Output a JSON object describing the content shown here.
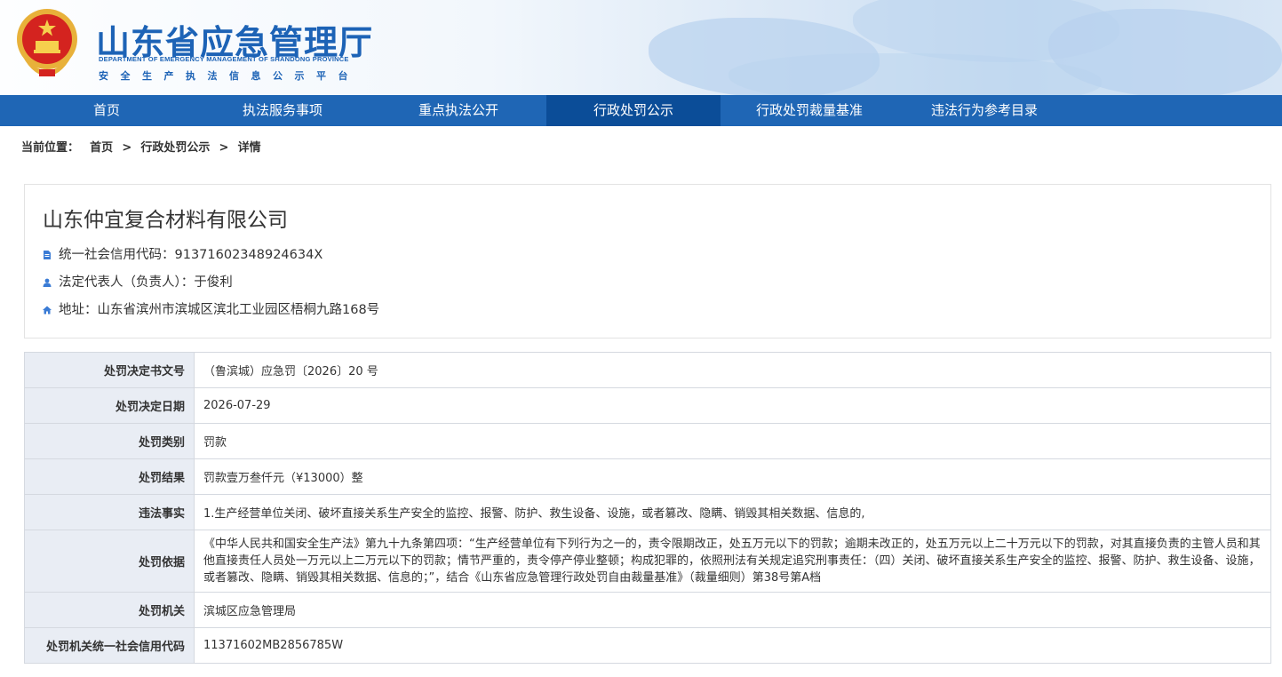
{
  "header": {
    "title": "山东省应急管理厅",
    "subtitle_en": "DEPARTMENT OF EMERGENCY MANAGEMENT OF SHANDONG PROVINCE",
    "platform": "安全生产执法信息公示平台"
  },
  "nav": {
    "items": [
      {
        "label": "首页"
      },
      {
        "label": "执法服务事项"
      },
      {
        "label": "重点执法公开"
      },
      {
        "label": "行政处罚公示",
        "active": true
      },
      {
        "label": "行政处罚裁量基准"
      },
      {
        "label": "违法行为参考目录"
      }
    ]
  },
  "breadcrumb": {
    "label": "当前位置：",
    "items": [
      "首页",
      "行政处罚公示",
      "详情"
    ],
    "separator": ">"
  },
  "company": {
    "name": "山东仲宜复合材料有限公司",
    "credit_code": "统一社会信用代码：91371602348924634X",
    "legal_rep": "法定代表人（负责人）：于俊利",
    "address": "地址：山东省滨州市滨城区滨北工业园区梧桐九路168号"
  },
  "details": [
    {
      "label": "处罚决定书文号",
      "value": "（鲁滨城）应急罚〔2026〕20 号"
    },
    {
      "label": "处罚决定日期",
      "value": "2026-07-29"
    },
    {
      "label": "处罚类别",
      "value": "罚款"
    },
    {
      "label": "处罚结果",
      "value": "罚款壹万叁仟元（¥13000）整"
    },
    {
      "label": "违法事实",
      "value": "1.生产经营单位关闭、破坏直接关系生产安全的监控、报警、防护、救生设备、设施，或者篡改、隐瞒、销毁其相关数据、信息的,"
    },
    {
      "label": "处罚依据",
      "value": "《中华人民共和国安全生产法》第九十九条第四项：“生产经营单位有下列行为之一的，责令限期改正，处五万元以下的罚款；逾期未改正的，处五万元以上二十万元以下的罚款，对其直接负责的主管人员和其他直接责任人员处一万元以上二万元以下的罚款；情节严重的，责令停产停业整顿；构成犯罪的，依照刑法有关规定追究刑事责任：（四）关闭、破坏直接关系生产安全的监控、报警、防护、救生设备、设施，或者篡改、隐瞒、销毁其相关数据、信息的；”，结合《山东省应急管理行政处罚自由裁量基准》（裁量细则）第38号第A档"
    },
    {
      "label": "处罚机关",
      "value": "滨城区应急管理局"
    },
    {
      "label": "处罚机关统一社会信用代码",
      "value": "11371602MB2856785W"
    }
  ],
  "colors": {
    "nav_bg": "#1f66b5",
    "nav_active": "#0b4d98",
    "title_blue": "#1d63b6",
    "label_bg": "#e9edf4",
    "icon_blue": "#3a7bd5"
  }
}
